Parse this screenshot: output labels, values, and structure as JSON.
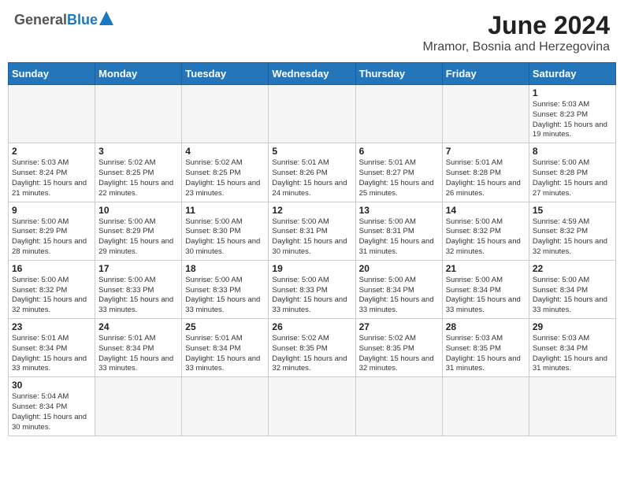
{
  "header": {
    "logo_general": "General",
    "logo_blue": "Blue",
    "month_title": "June 2024",
    "location": "Mramor, Bosnia and Herzegovina"
  },
  "days_of_week": [
    "Sunday",
    "Monday",
    "Tuesday",
    "Wednesday",
    "Thursday",
    "Friday",
    "Saturday"
  ],
  "weeks": [
    [
      {
        "day": "",
        "info": ""
      },
      {
        "day": "",
        "info": ""
      },
      {
        "day": "",
        "info": ""
      },
      {
        "day": "",
        "info": ""
      },
      {
        "day": "",
        "info": ""
      },
      {
        "day": "",
        "info": ""
      },
      {
        "day": "1",
        "info": "Sunrise: 5:03 AM\nSunset: 8:23 PM\nDaylight: 15 hours and 19 minutes."
      }
    ],
    [
      {
        "day": "2",
        "info": "Sunrise: 5:03 AM\nSunset: 8:24 PM\nDaylight: 15 hours and 21 minutes."
      },
      {
        "day": "3",
        "info": "Sunrise: 5:02 AM\nSunset: 8:25 PM\nDaylight: 15 hours and 22 minutes."
      },
      {
        "day": "4",
        "info": "Sunrise: 5:02 AM\nSunset: 8:25 PM\nDaylight: 15 hours and 23 minutes."
      },
      {
        "day": "5",
        "info": "Sunrise: 5:01 AM\nSunset: 8:26 PM\nDaylight: 15 hours and 24 minutes."
      },
      {
        "day": "6",
        "info": "Sunrise: 5:01 AM\nSunset: 8:27 PM\nDaylight: 15 hours and 25 minutes."
      },
      {
        "day": "7",
        "info": "Sunrise: 5:01 AM\nSunset: 8:28 PM\nDaylight: 15 hours and 26 minutes."
      },
      {
        "day": "8",
        "info": "Sunrise: 5:00 AM\nSunset: 8:28 PM\nDaylight: 15 hours and 27 minutes."
      }
    ],
    [
      {
        "day": "9",
        "info": "Sunrise: 5:00 AM\nSunset: 8:29 PM\nDaylight: 15 hours and 28 minutes."
      },
      {
        "day": "10",
        "info": "Sunrise: 5:00 AM\nSunset: 8:29 PM\nDaylight: 15 hours and 29 minutes."
      },
      {
        "day": "11",
        "info": "Sunrise: 5:00 AM\nSunset: 8:30 PM\nDaylight: 15 hours and 30 minutes."
      },
      {
        "day": "12",
        "info": "Sunrise: 5:00 AM\nSunset: 8:31 PM\nDaylight: 15 hours and 30 minutes."
      },
      {
        "day": "13",
        "info": "Sunrise: 5:00 AM\nSunset: 8:31 PM\nDaylight: 15 hours and 31 minutes."
      },
      {
        "day": "14",
        "info": "Sunrise: 5:00 AM\nSunset: 8:32 PM\nDaylight: 15 hours and 32 minutes."
      },
      {
        "day": "15",
        "info": "Sunrise: 4:59 AM\nSunset: 8:32 PM\nDaylight: 15 hours and 32 minutes."
      }
    ],
    [
      {
        "day": "16",
        "info": "Sunrise: 5:00 AM\nSunset: 8:32 PM\nDaylight: 15 hours and 32 minutes."
      },
      {
        "day": "17",
        "info": "Sunrise: 5:00 AM\nSunset: 8:33 PM\nDaylight: 15 hours and 33 minutes."
      },
      {
        "day": "18",
        "info": "Sunrise: 5:00 AM\nSunset: 8:33 PM\nDaylight: 15 hours and 33 minutes."
      },
      {
        "day": "19",
        "info": "Sunrise: 5:00 AM\nSunset: 8:33 PM\nDaylight: 15 hours and 33 minutes."
      },
      {
        "day": "20",
        "info": "Sunrise: 5:00 AM\nSunset: 8:34 PM\nDaylight: 15 hours and 33 minutes."
      },
      {
        "day": "21",
        "info": "Sunrise: 5:00 AM\nSunset: 8:34 PM\nDaylight: 15 hours and 33 minutes."
      },
      {
        "day": "22",
        "info": "Sunrise: 5:00 AM\nSunset: 8:34 PM\nDaylight: 15 hours and 33 minutes."
      }
    ],
    [
      {
        "day": "23",
        "info": "Sunrise: 5:01 AM\nSunset: 8:34 PM\nDaylight: 15 hours and 33 minutes."
      },
      {
        "day": "24",
        "info": "Sunrise: 5:01 AM\nSunset: 8:34 PM\nDaylight: 15 hours and 33 minutes."
      },
      {
        "day": "25",
        "info": "Sunrise: 5:01 AM\nSunset: 8:34 PM\nDaylight: 15 hours and 33 minutes."
      },
      {
        "day": "26",
        "info": "Sunrise: 5:02 AM\nSunset: 8:35 PM\nDaylight: 15 hours and 32 minutes."
      },
      {
        "day": "27",
        "info": "Sunrise: 5:02 AM\nSunset: 8:35 PM\nDaylight: 15 hours and 32 minutes."
      },
      {
        "day": "28",
        "info": "Sunrise: 5:03 AM\nSunset: 8:35 PM\nDaylight: 15 hours and 31 minutes."
      },
      {
        "day": "29",
        "info": "Sunrise: 5:03 AM\nSunset: 8:34 PM\nDaylight: 15 hours and 31 minutes."
      }
    ],
    [
      {
        "day": "30",
        "info": "Sunrise: 5:04 AM\nSunset: 8:34 PM\nDaylight: 15 hours and 30 minutes."
      },
      {
        "day": "",
        "info": ""
      },
      {
        "day": "",
        "info": ""
      },
      {
        "day": "",
        "info": ""
      },
      {
        "day": "",
        "info": ""
      },
      {
        "day": "",
        "info": ""
      },
      {
        "day": "",
        "info": ""
      }
    ]
  ]
}
